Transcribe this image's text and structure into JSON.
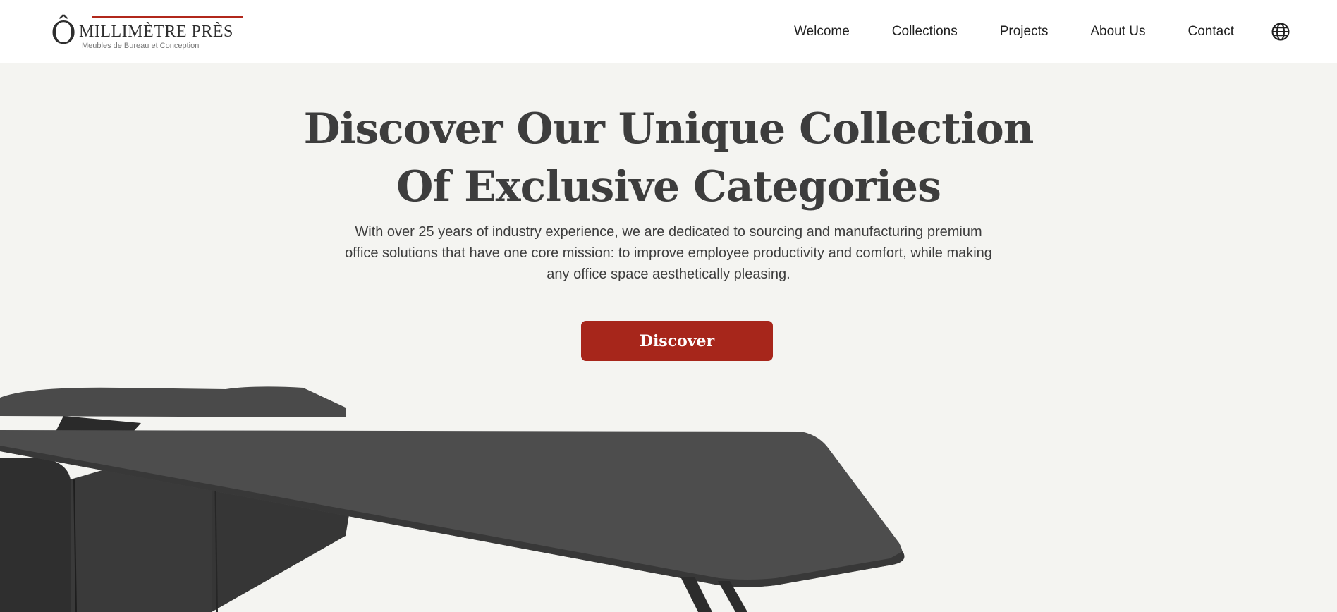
{
  "brand": {
    "logo_mark": "Ô",
    "name": "MILLIMÈTRE PRÈS",
    "tagline": "Meubles de Bureau et Conception",
    "accent_color": "#a7261b"
  },
  "nav": {
    "items": [
      {
        "label": "Welcome"
      },
      {
        "label": "Collections"
      },
      {
        "label": "Projects"
      },
      {
        "label": "About Us"
      },
      {
        "label": "Contact"
      }
    ],
    "language_icon": "globe-icon"
  },
  "hero": {
    "title_line1": "Discover Our Unique Collection",
    "title_line2": "Of Exclusive Categories",
    "subtitle": "With over 25 years of industry experience, we are dedicated to sourcing and manufacturing premium office solutions that have one core mission: to improve employee productivity and comfort, while making any office space aesthetically pleasing.",
    "cta_label": "Discover"
  }
}
